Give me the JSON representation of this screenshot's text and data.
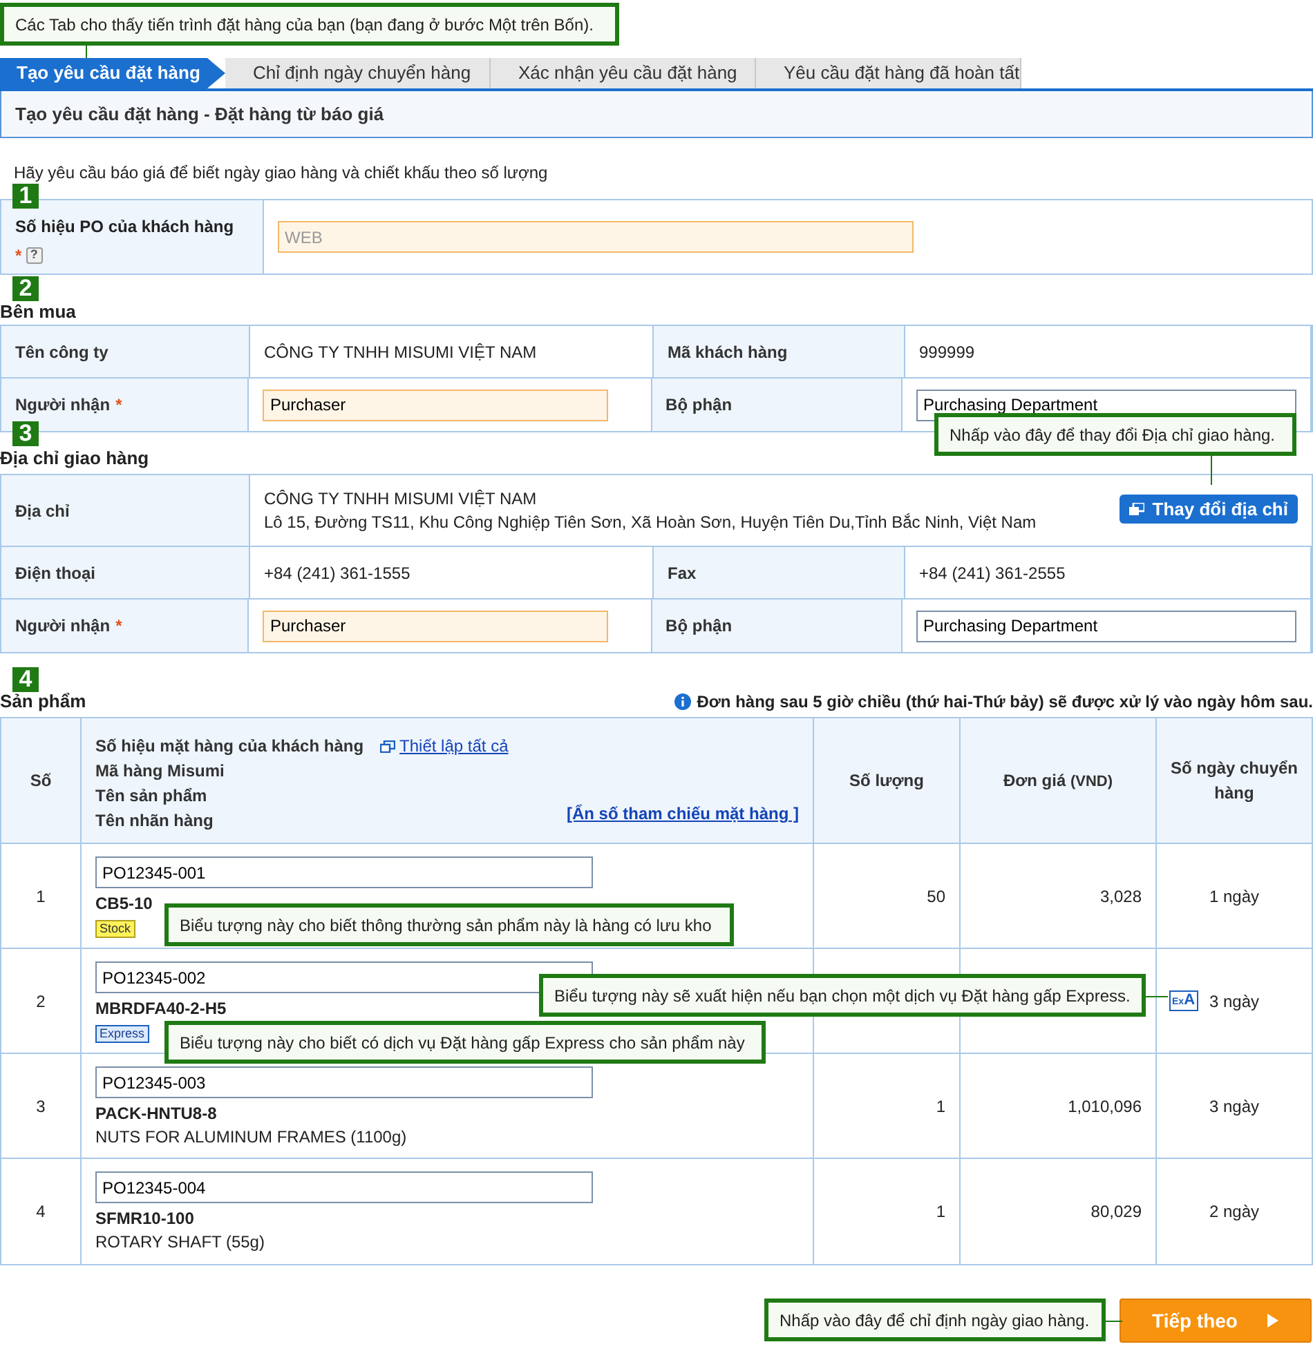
{
  "callouts": [
    {
      "text": "Các Tab cho thấy tiến trình đặt hàng của bạn (bạn đang ở bước Một trên Bốn)."
    },
    {
      "text": "Nhấp vào đây để thay đổi Địa chỉ giao hàng."
    },
    {
      "text": "Biểu tượng này cho biết thông thường sản phẩm này là hàng có lưu kho"
    },
    {
      "text": "Biểu tượng này sẽ xuất hiện nếu bạn chọn một dịch vụ Đặt hàng gấp Express."
    },
    {
      "text": "Biểu tượng này cho biết có dịch vụ Đặt hàng gấp Express cho sản phẩm này"
    },
    {
      "text": "Nhấp vào đây để chỉ định ngày giao hàng."
    }
  ],
  "tabs": [
    {
      "label": "Tạo yêu cầu đặt hàng",
      "selected": true
    },
    {
      "label": "Chỉ định ngày chuyển hàng",
      "selected": false
    },
    {
      "label": "Xác nhận yêu cầu đặt hàng",
      "selected": false
    },
    {
      "label": "Yêu cầu đặt hàng đã hoàn tất",
      "selected": false
    }
  ],
  "page_title": "Tạo yêu cầu đặt hàng - Đặt hàng từ báo giá",
  "intro": "Hãy yêu cầu báo giá để biết ngày giao hàng và chiết khấu theo số lượng",
  "po": {
    "step": "1",
    "label": "Số hiệu PO của khách hàng",
    "mark": "*",
    "help": "?",
    "placeholder": "WEB"
  },
  "buyer": {
    "step": "2",
    "title": "Bên mua",
    "rows": [
      [
        {
          "kind": "label",
          "text": "Tên công ty"
        },
        {
          "kind": "text",
          "text": "CÔNG TY TNHH MISUMI VIỆT NAM"
        },
        {
          "kind": "label",
          "text": "Mã khách hàng"
        },
        {
          "kind": "text",
          "text": "999999"
        }
      ],
      [
        {
          "kind": "label",
          "text": "Người nhận",
          "mark": "*"
        },
        {
          "kind": "input",
          "value": "Purchaser",
          "required": true
        },
        {
          "kind": "label",
          "text": "Bộ phận"
        },
        {
          "kind": "input",
          "value": "Purchasing Department",
          "required": false
        }
      ]
    ]
  },
  "shipping": {
    "step": "3",
    "title": "Địa chỉ giao hàng",
    "address_label": "Địa chỉ",
    "address_lines": [
      "CÔNG TY TNHH MISUMI VIỆT NAM",
      "Lô 15, Đường TS11, Khu Công Nghiệp Tiên Sơn, Xã Hoàn Sơn, Huyện Tiên Du,Tỉnh Bắc Ninh, Việt Nam"
    ],
    "change_button": "Thay đổi địa chỉ",
    "rows": [
      [
        {
          "kind": "label",
          "text": "Điện thoại"
        },
        {
          "kind": "text",
          "text": "+84 (241) 361-1555"
        },
        {
          "kind": "label",
          "text": "Fax"
        },
        {
          "kind": "text",
          "text": "+84 (241) 361-2555"
        }
      ],
      [
        {
          "kind": "label",
          "text": "Người nhận",
          "mark": "*"
        },
        {
          "kind": "input",
          "value": "Purchaser",
          "required": true
        },
        {
          "kind": "label",
          "text": "Bộ phận"
        },
        {
          "kind": "input",
          "value": "Purchasing Department",
          "required": false
        }
      ]
    ]
  },
  "products": {
    "step": "4",
    "title": "Sản phẩm",
    "notice": "Đơn hàng sau 5 giờ chiều (thứ hai-Thứ bảy) sẽ được xử lý vào ngày hôm sau.",
    "columns": {
      "no": "Số",
      "item_lines": [
        "Số hiệu mặt hàng của khách hàng",
        "Mã hàng Misumi",
        "Tên sản phẩm",
        "Tên nhãn hàng"
      ],
      "set_all": "Thiết lập tất cả",
      "hide_ref": "[Ẩn số tham chiếu mặt hàng ]",
      "quantity": "Số lượng",
      "price": "Đơn giá",
      "price_unit": "(VND)",
      "days": "Số ngày chuyển hàng"
    },
    "rows": [
      {
        "no": "1",
        "po": "PO12345-001",
        "code": "CB5-10",
        "badge": {
          "kind": "stock",
          "text": "Stock"
        },
        "quantity": "50",
        "price": "3,028",
        "days": "1 ngày"
      },
      {
        "no": "2",
        "po": "PO12345-002",
        "code": "MBRDFA40-2-H5",
        "badge": {
          "kind": "express",
          "text": "Express"
        },
        "service_mark": {
          "small": "Ex",
          "large": "A"
        },
        "days": "3 ngày"
      },
      {
        "no": "3",
        "po": "PO12345-003",
        "code": "PACK-HNTU8-8",
        "name": "NUTS FOR ALUMINUM FRAMES (1100g)",
        "quantity": "1",
        "price": "1,010,096",
        "days": "3 ngày"
      },
      {
        "no": "4",
        "po": "PO12345-004",
        "code": "SFMR10-100",
        "name": "ROTARY SHAFT (55g)",
        "quantity": "1",
        "price": "80,029",
        "days": "2 ngày"
      }
    ]
  },
  "next_button": "Tiếp theo"
}
